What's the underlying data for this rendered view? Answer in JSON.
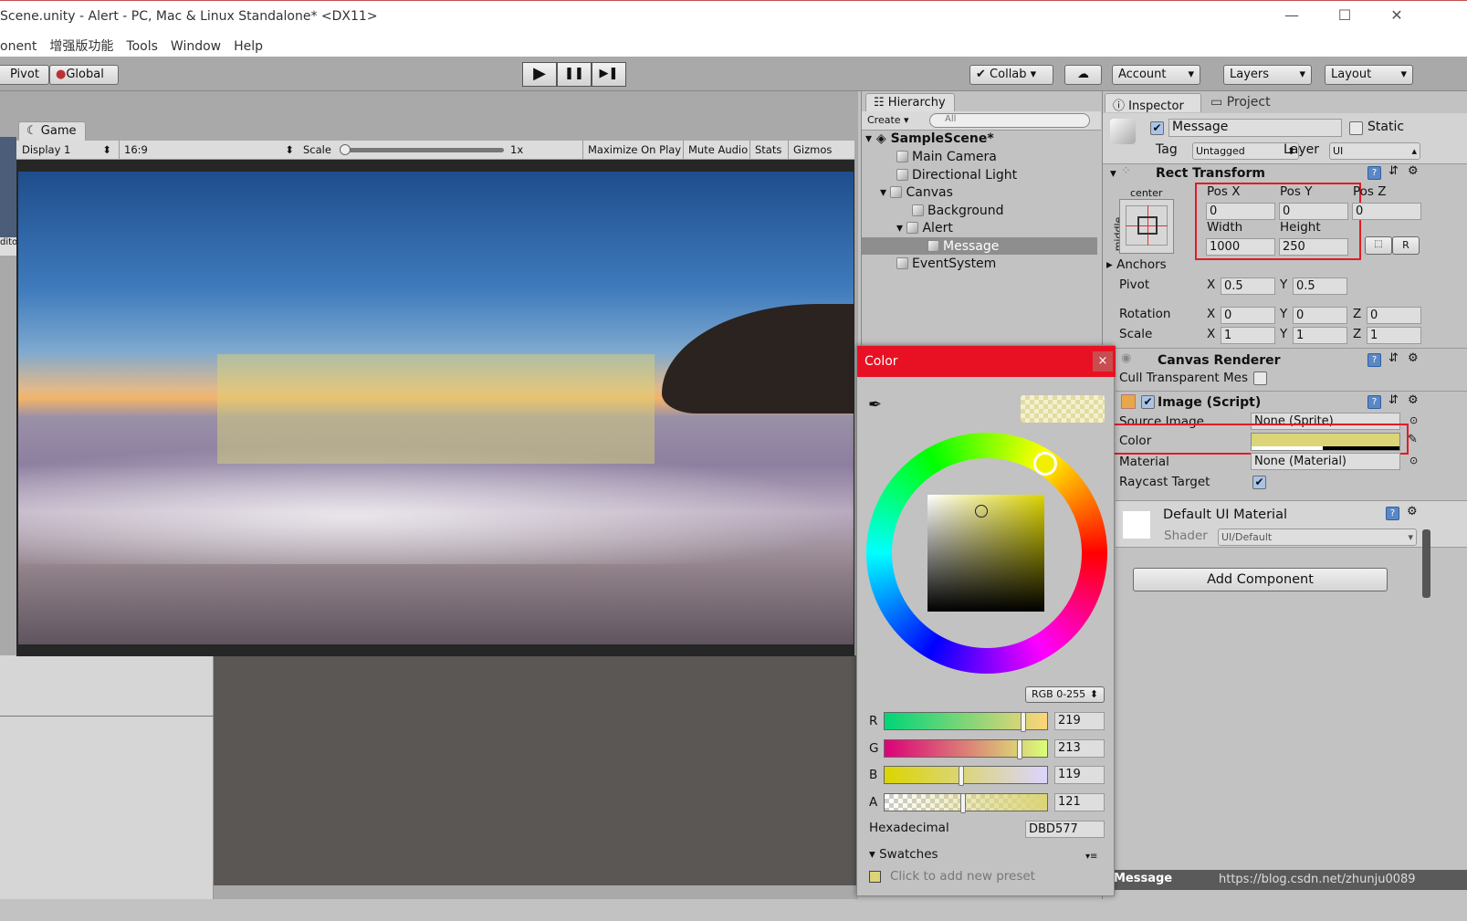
{
  "window": {
    "title": "Scene.unity - Alert - PC, Mac & Linux Standalone* <DX11>",
    "controls": [
      "—",
      "☐",
      "✕"
    ]
  },
  "menu": [
    "onent",
    "增强版功能",
    "Tools",
    "Window",
    "Help"
  ],
  "toolbar": {
    "pivot": "Pivot",
    "global": "Global",
    "play": "▶",
    "pause": "❚❚",
    "step": "▶❚",
    "collab": "Collab",
    "account": "Account",
    "layers": "Layers",
    "layout": "Layout"
  },
  "game": {
    "tab": "Game",
    "display": "Display 1",
    "aspect": "16:9",
    "scale_label": "Scale",
    "scale_value": "1x",
    "maximize": "Maximize On Play",
    "mute": "Mute Audio",
    "stats": "Stats",
    "gizmos": "Gizmos",
    "left_stub": "dito"
  },
  "hierarchy": {
    "tab": "Hierarchy",
    "create": "Create",
    "search_placeholder": "All",
    "scene": "SampleScene*",
    "items": [
      {
        "label": "Main Camera",
        "depth": 1
      },
      {
        "label": "Directional Light",
        "depth": 1
      },
      {
        "label": "Canvas",
        "depth": 1,
        "expanded": true
      },
      {
        "label": "Background",
        "depth": 2
      },
      {
        "label": "Alert",
        "depth": 2,
        "expanded": true
      },
      {
        "label": "Message",
        "depth": 3,
        "selected": true
      },
      {
        "label": "EventSystem",
        "depth": 1
      }
    ]
  },
  "color_picker": {
    "title": "Color",
    "close": "×",
    "mode": "RGB 0-255",
    "channels": [
      {
        "name": "R",
        "value": "219",
        "fraction": 0.859
      },
      {
        "name": "G",
        "value": "213",
        "fraction": 0.835
      },
      {
        "name": "B",
        "value": "119",
        "fraction": 0.467
      },
      {
        "name": "A",
        "value": "121",
        "fraction": 0.475
      }
    ],
    "hex_label": "Hexadecimal",
    "hex": "DBD577",
    "swatches": "Swatches",
    "add_preset": "Click to add new preset",
    "color": "#DBD577",
    "header_color": "#E81123"
  },
  "inspector": {
    "tab": "Inspector",
    "project_tab": "Project",
    "name": "Message",
    "static": "Static",
    "tag_label": "Tag",
    "tag": "Untagged",
    "layer_label": "Layer",
    "layer": "UI",
    "rect": {
      "title": "Rect Transform",
      "anchor_h": "center",
      "anchor_v": "middle",
      "posx_l": "Pos X",
      "posy_l": "Pos Y",
      "posz_l": "Pos Z",
      "posx": "0",
      "posy": "0",
      "posz": "0",
      "width_l": "Width",
      "height_l": "Height",
      "width": "1000",
      "height": "250",
      "r_btn": "R",
      "anchors": "Anchors",
      "pivot": "Pivot",
      "pivot_x": "0.5",
      "pivot_y": "0.5",
      "rotation": "Rotation",
      "rot_x": "0",
      "rot_y": "0",
      "rot_z": "0",
      "scale": "Scale",
      "scale_x": "1",
      "scale_y": "1",
      "scale_z": "1",
      "x": "X",
      "y": "Y",
      "z": "Z"
    },
    "canvas_renderer": {
      "title": "Canvas Renderer",
      "cull": "Cull Transparent Mes"
    },
    "image": {
      "title": "Image (Script)",
      "source_l": "Source Image",
      "source": "None (Sprite)",
      "color_l": "Color",
      "material_l": "Material",
      "material": "None (Material)",
      "raycast": "Raycast Target"
    },
    "material": {
      "title": "Default UI Material",
      "shader_l": "Shader",
      "shader": "UI/Default"
    },
    "add_component": "Add Component"
  },
  "status": {
    "left": "Message",
    "watermark": "https://blog.csdn.net/zhunju0089"
  }
}
